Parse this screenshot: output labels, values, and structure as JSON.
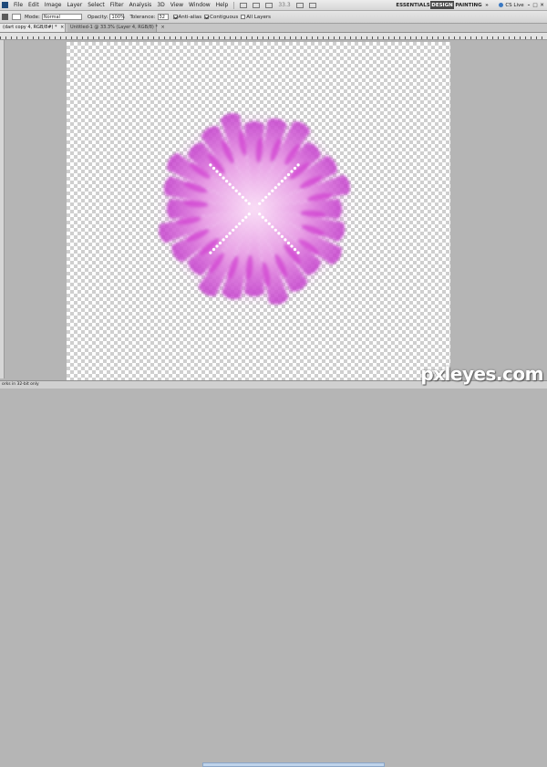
{
  "menu": {
    "items": [
      "File",
      "Edit",
      "Image",
      "Layer",
      "Select",
      "Filter",
      "Analysis",
      "3D",
      "View",
      "Window",
      "Help"
    ],
    "zoom": "33.3"
  },
  "workspaces": {
    "essentials": "ESSENTIALS",
    "design": "DESIGN",
    "painting": "PAINTING",
    "more": "»",
    "cs_live": "CS Live"
  },
  "options": {
    "mode_label": "Mode:",
    "mode_value": "Normal",
    "opacity_label": "Opacity:",
    "opacity_value": "100%",
    "tolerance_label": "Tolerance:",
    "tolerance_value": "32",
    "anti_alias": "Anti-alias",
    "contiguous": "Contiguous",
    "all_layers": "All Layers"
  },
  "tabs": [
    {
      "label": "(dart copy 4, RGB/8#) *"
    },
    {
      "label": "Untitled-1 @ 33.3% (Layer 4, RGB/8) *"
    }
  ],
  "status": {
    "text": "orks in 32-bit only"
  },
  "watermark": "pxleyes.com",
  "colors": {
    "petal_magenta": "#d23fd2",
    "petal_light": "#f4c6f0",
    "glow": "#e9a9ec",
    "canvas_bg": "#b5b5b5"
  }
}
